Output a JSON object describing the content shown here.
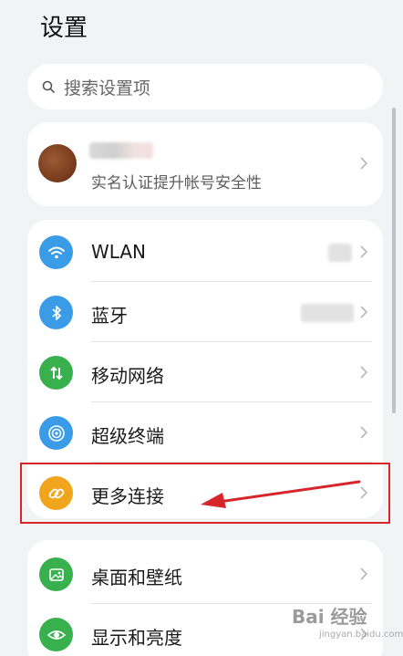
{
  "header": {
    "title": "设置"
  },
  "search": {
    "placeholder": "搜索设置项",
    "icon": "search-icon"
  },
  "account": {
    "subtitle": "实名认证提升帐号安全性"
  },
  "connectivity": {
    "items": [
      {
        "label": "WLAN",
        "icon": "wifi-icon",
        "color": "#3a9be6"
      },
      {
        "label": "蓝牙",
        "icon": "bluetooth-icon",
        "color": "#3a9be6"
      },
      {
        "label": "移动网络",
        "icon": "mobile-data-icon",
        "color": "#38b04e"
      },
      {
        "label": "超级终端",
        "icon": "super-device-icon",
        "color": "#3a9be6"
      },
      {
        "label": "更多连接",
        "icon": "link-icon",
        "color": "#f0a51d"
      }
    ]
  },
  "display": {
    "items": [
      {
        "label": "桌面和壁纸",
        "icon": "wallpaper-icon",
        "color": "#38b04e"
      },
      {
        "label": "显示和亮度",
        "icon": "eye-icon",
        "color": "#38b04e"
      }
    ]
  },
  "annotation": {
    "highlight_color": "#d7262b"
  },
  "watermark": {
    "text": "Bai 经验",
    "sub": "jingyan.baidu.com"
  }
}
